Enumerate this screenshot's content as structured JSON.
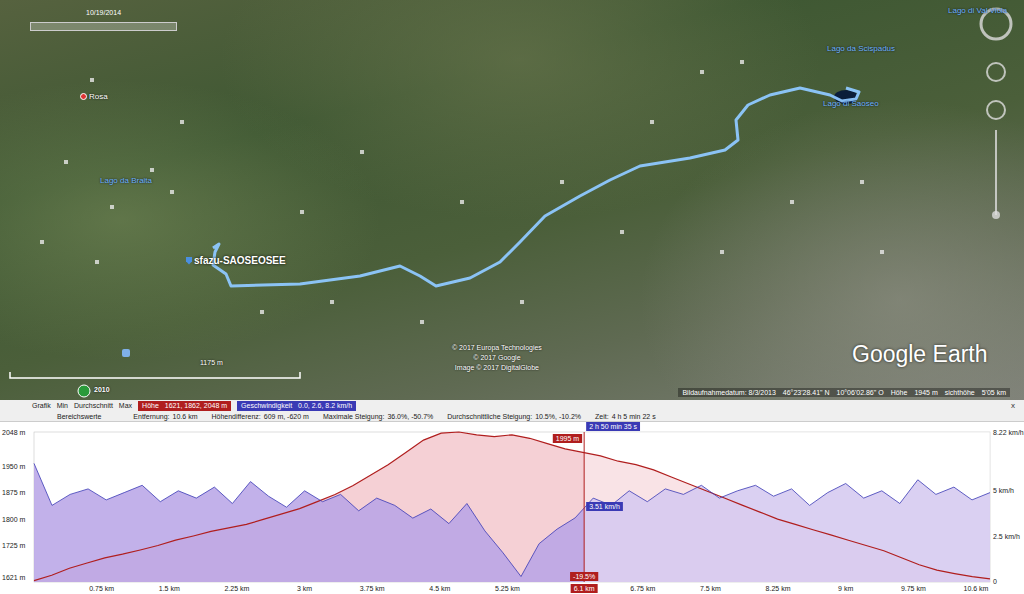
{
  "map": {
    "time_slider": {
      "label": "10/19/2014"
    },
    "labels": [
      {
        "text": "Rosa",
        "kind": "place"
      },
      {
        "text": "Lago da Braita",
        "kind": "lake"
      },
      {
        "text": "sfazu-SAOSEOSEE",
        "kind": "track"
      },
      {
        "text": "Lago da Scispadus",
        "kind": "lake"
      },
      {
        "text": "Lago di Saoseo",
        "kind": "lake"
      },
      {
        "text": "Lago di Val Viola",
        "kind": "lake"
      }
    ],
    "scale": "1175 m",
    "historical_year": "2010",
    "credits": [
      "© 2017 Europa Technologies",
      "© 2017 Google",
      "Image © 2017 DigitalGlobe"
    ],
    "logo": "Google Earth",
    "status_bar": [
      "Bildaufnahmedatum: 8/3/2013",
      "46°23'28.41\" N",
      "10°06'02.86\" O",
      "Höhe",
      "1945 m",
      "sichthöhe",
      "5'05 km"
    ]
  },
  "profile": {
    "columns": [
      "Grafik",
      "Min",
      "Durchschnitt",
      "Max"
    ],
    "series_legend": [
      {
        "label": "Höhe",
        "values": "1621, 1862, 2048 m",
        "color": "#b01e1e"
      },
      {
        "label": "Geschwindigkeit",
        "values": "0.0, 2.6, 8.2 km/h",
        "color": "#3a3ab5"
      }
    ],
    "close": "x",
    "range_title": "Bereichswerte",
    "range_values": [
      {
        "label": "Entfernung:",
        "value": "10.6 km"
      },
      {
        "label": "Höhendifferenz:",
        "value": "609 m, -620 m"
      },
      {
        "label": "Maximale Steigung:",
        "value": "36.0%, -50.7%"
      },
      {
        "label": "Durchschnittliche Steigung:",
        "value": "10.5%, -10.2%"
      },
      {
        "label": "Zeit:",
        "value": "4 h 5 min 22 s"
      }
    ]
  },
  "chart": {
    "x_max": 10.6,
    "y_left_ticks": [
      {
        "label": "2048 m",
        "value": 2048
      },
      {
        "label": "1950 m",
        "value": 1950
      },
      {
        "label": "1875 m",
        "value": 1875
      },
      {
        "label": "1800 m",
        "value": 1800
      },
      {
        "label": "1725 m",
        "value": 1725
      },
      {
        "label": "1621 m",
        "value": 1621
      }
    ],
    "y_right_ticks": [
      {
        "label": "8.22 km/h",
        "value": 8.22
      },
      {
        "label": "5 km/h",
        "value": 5
      },
      {
        "label": "2.5 km/h",
        "value": 2.5
      },
      {
        "label": "0",
        "value": 0
      }
    ],
    "x_ticks": [
      {
        "label": "0.75 km",
        "value": 0.75
      },
      {
        "label": "1.5 km",
        "value": 1.5
      },
      {
        "label": "2.25 km",
        "value": 2.25
      },
      {
        "label": "3 km",
        "value": 3
      },
      {
        "label": "3.75 km",
        "value": 3.75
      },
      {
        "label": "4.5 km",
        "value": 4.5
      },
      {
        "label": "5.25 km",
        "value": 5.25
      },
      {
        "label": "6.75 km",
        "value": 6.75
      },
      {
        "label": "7.5 km",
        "value": 7.5
      },
      {
        "label": "8.25 km",
        "value": 8.25
      },
      {
        "label": "9 km",
        "value": 9
      },
      {
        "label": "9.75 km",
        "value": 9.75
      },
      {
        "label": "10.6 km",
        "value": 10.6
      }
    ],
    "series": [
      {
        "name": "elevation",
        "values": [
          1625,
          1640,
          1660,
          1675,
          1690,
          1700,
          1712,
          1725,
          1740,
          1752,
          1765,
          1775,
          1785,
          1800,
          1815,
          1830,
          1850,
          1870,
          1895,
          1925,
          1955,
          1990,
          2025,
          2045,
          2048,
          2040,
          2035,
          2040,
          2030,
          2015,
          2000,
          1990,
          1980,
          1965,
          1955,
          1940,
          1920,
          1900,
          1880,
          1860,
          1840,
          1820,
          1800,
          1785,
          1770,
          1755,
          1740,
          1725,
          1710,
          1690,
          1670,
          1655,
          1645,
          1636,
          1630
        ]
      },
      {
        "name": "speed",
        "values": [
          6.5,
          4.2,
          4.8,
          5.1,
          4.5,
          4.9,
          5.3,
          4.4,
          5.0,
          4.6,
          5.2,
          4.3,
          5.5,
          4.7,
          4.1,
          5.0,
          4.4,
          4.8,
          3.9,
          4.6,
          4.2,
          3.5,
          4.0,
          3.2,
          4.3,
          2.8,
          1.6,
          0.3,
          2.1,
          2.9,
          3.51,
          4.6,
          4.2,
          5.0,
          4.4,
          5.1,
          4.8,
          5.3,
          4.6,
          5.0,
          5.3,
          4.7,
          5.1,
          4.2,
          4.9,
          5.4,
          4.6,
          5.0,
          4.3,
          5.6,
          4.8,
          5.2,
          4.5,
          4.9
        ]
      }
    ],
    "cursor": {
      "at": 6.1,
      "distance": "6.1 km",
      "time": "2 h 50 min 35 s",
      "elevation": "1995 m",
      "speed": "3.51 km/h",
      "grade": "-19.5%"
    }
  }
}
